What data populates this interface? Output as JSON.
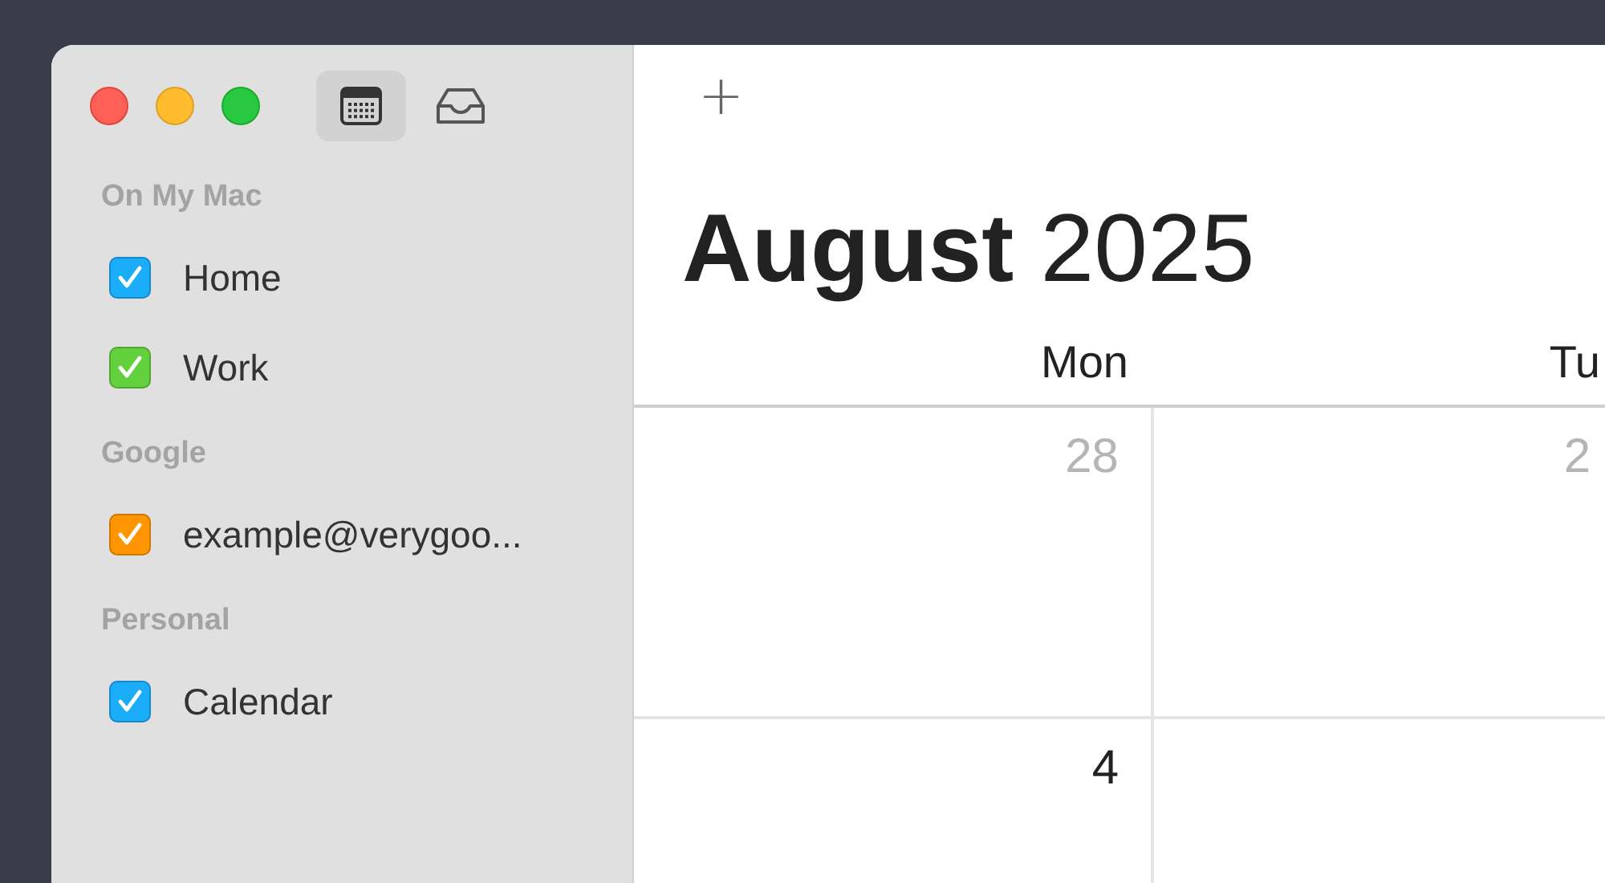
{
  "toolbar": {
    "view_buttons": [
      {
        "kind": "calendar",
        "selected": true
      },
      {
        "kind": "inbox",
        "selected": false
      }
    ],
    "add_button": "+"
  },
  "sidebar": {
    "sections": [
      {
        "title": "On My Mac",
        "items": [
          {
            "label": "Home",
            "checked": true,
            "color": "#1badf8"
          },
          {
            "label": "Work",
            "checked": true,
            "color": "#63d13e"
          }
        ]
      },
      {
        "title": "Google",
        "items": [
          {
            "label": "example@verygoo...",
            "checked": true,
            "color": "#ff9500"
          }
        ]
      },
      {
        "title": "Personal",
        "items": [
          {
            "label": "Calendar",
            "checked": true,
            "color": "#1badf8"
          }
        ]
      }
    ]
  },
  "calendar": {
    "title": "**August** 2025",
    "day_headers": [
      "Mon",
      "Tu"
    ],
    "weeks": [
      [
        {
          "day": "28",
          "other_month": true
        },
        {
          "day": "2",
          "other_month": true
        }
      ],
      [
        {
          "day": "4",
          "other_month": false
        }
      ]
    ]
  }
}
